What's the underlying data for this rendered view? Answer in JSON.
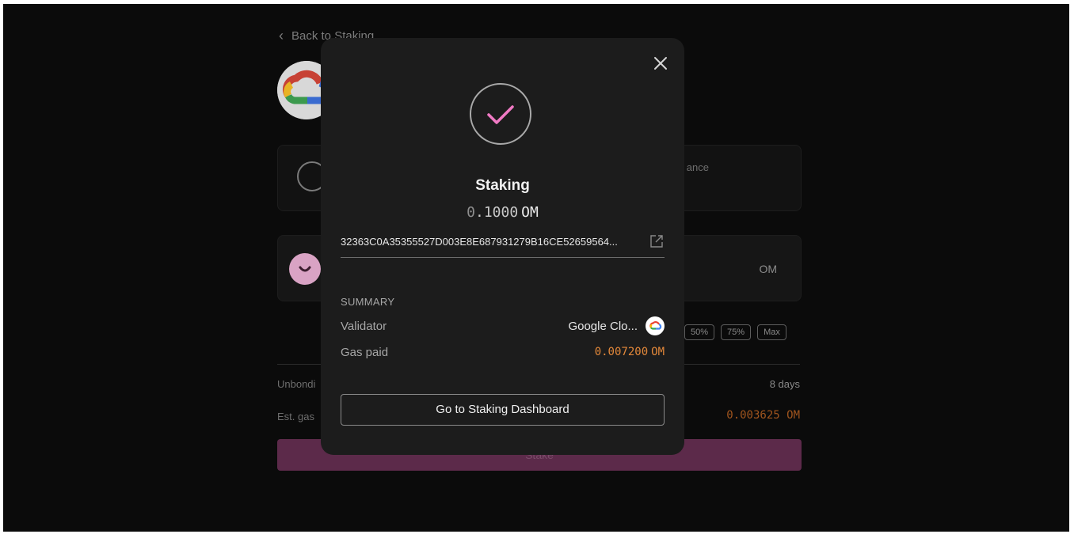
{
  "background": {
    "back_link": "Back to Staking",
    "balance_label": "ance",
    "om_unit": "OM",
    "percent_buttons": [
      "50%",
      "75%",
      "Max"
    ],
    "unbonding_label": "Unbondi",
    "unbonding_value": "8 days",
    "est_gas_label": "Est. gas",
    "est_gas_value": "0.003625",
    "est_gas_unit": "OM",
    "stake_button": "Stake"
  },
  "modal": {
    "title": "Staking",
    "amount_zero": "0",
    "amount_rest": ".1000",
    "amount_unit": "OM",
    "tx_hash": "32363C0A35355527D003E8E687931279B16CE52659564...",
    "summary_label": "SUMMARY",
    "validator_label": "Validator",
    "validator_value": "Google Clo...",
    "gas_label": "Gas paid",
    "gas_value": "0.007200",
    "gas_unit": "OM",
    "dashboard_button": "Go to Staking Dashboard"
  },
  "icons": {
    "check": "check-icon",
    "close": "close-icon",
    "external_link": "external-link-icon",
    "validator_logo": "google-cloud-icon"
  },
  "colors": {
    "accent_pink": "#f07ac4",
    "gas_orange": "#e3883a",
    "modal_bg": "#1c1c1c"
  }
}
